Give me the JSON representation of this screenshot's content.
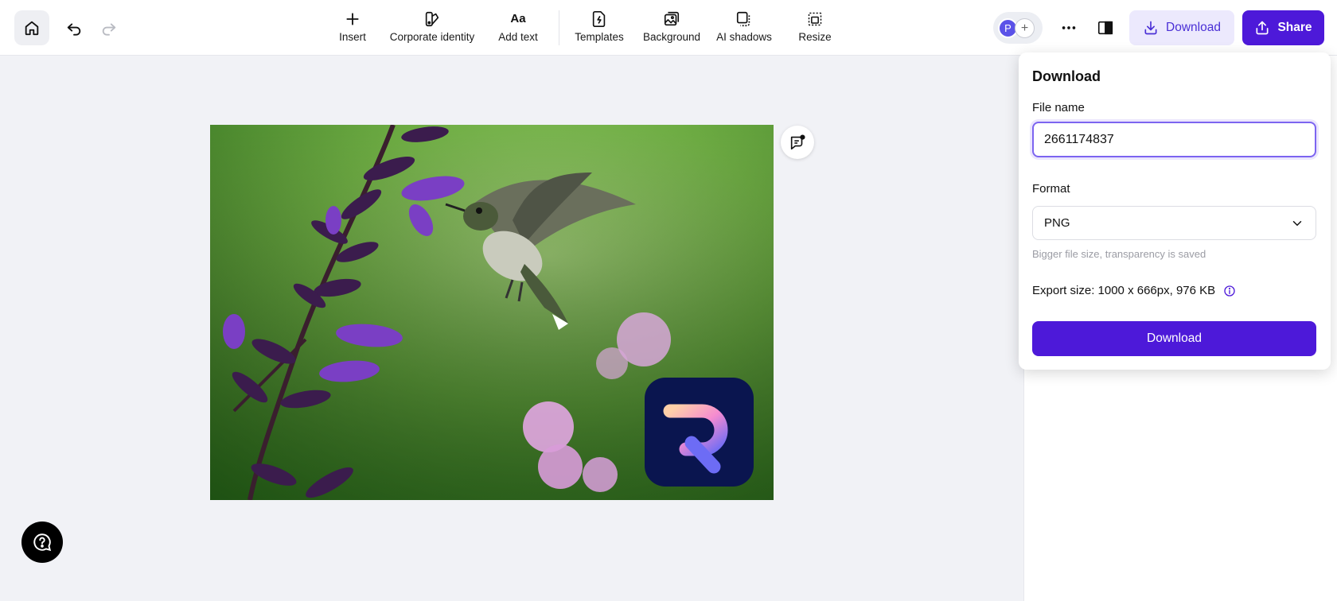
{
  "toolbar": {
    "tools": [
      {
        "label": "Insert",
        "icon": "plus-icon"
      },
      {
        "label": "Corporate identity",
        "icon": "brand-icon"
      },
      {
        "label": "Add text",
        "icon": "text-icon",
        "glyph": "Aa"
      },
      {
        "label": "Templates",
        "icon": "templates-icon"
      },
      {
        "label": "Background",
        "icon": "background-icon"
      },
      {
        "label": "AI shadows",
        "icon": "ai-shadows-icon"
      },
      {
        "label": "Resize",
        "icon": "resize-icon"
      }
    ],
    "avatar_initial": "P",
    "download_label": "Download",
    "share_label": "Share"
  },
  "download_popover": {
    "title": "Download",
    "file_name_label": "File name",
    "file_name_value": "2661174837",
    "format_label": "Format",
    "format_value": "PNG",
    "format_hint": "Bigger file size, transparency is saved",
    "export_size": "Export size: 1000 x 666px, 976 KB",
    "download_button": "Download"
  },
  "colors": {
    "accent": "#4d19d9",
    "accent_light": "#ece9fd",
    "canvas_bg": "#f1f2f6"
  }
}
